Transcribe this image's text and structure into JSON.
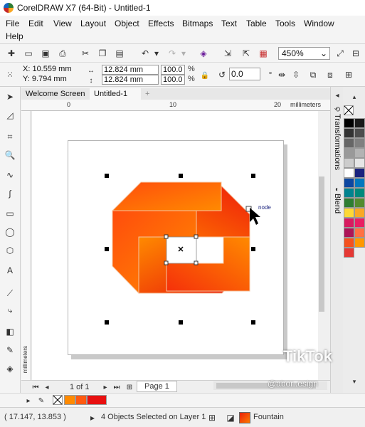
{
  "window": {
    "title": "CorelDRAW X7 (64-Bit) - Untitled-1"
  },
  "menu": {
    "items": [
      "File",
      "Edit",
      "View",
      "Layout",
      "Object",
      "Effects",
      "Bitmaps",
      "Text",
      "Table",
      "Tools",
      "Window"
    ],
    "row2": [
      "Help"
    ]
  },
  "toolbar": {
    "zoom": "450%",
    "zoom_options": [
      "450%"
    ]
  },
  "properties": {
    "x": "X: 10.559 mm",
    "y": "Y: 9.794 mm",
    "width": "12.824 mm",
    "height": "12.824 mm",
    "scale_x": "100.0",
    "scale_y": "100.0",
    "pct_x": "%",
    "pct_y": "%",
    "rotation": "0.0"
  },
  "tabs": [
    "Welcome Screen",
    "Untitled-1"
  ],
  "ruler": {
    "h_ticks": [
      "0",
      "10",
      "20"
    ],
    "unit": "millimeters",
    "v_unit": "millimeters"
  },
  "canvas": {
    "node_label": "node",
    "watermark": "TikTok",
    "watermark_handle": "@abor..esign"
  },
  "dockers": [
    "Transformations",
    "Blend"
  ],
  "palette": {
    "colors": [
      "#000000",
      "#1a1a1a",
      "#333333",
      "#4d4d4d",
      "#666666",
      "#808080",
      "#999999",
      "#b3b3b3",
      "#cccccc",
      "#e6e6e6",
      "#ffffff",
      "#1a237e",
      "#0d47a1",
      "#0277bd",
      "#00838f",
      "#00897b",
      "#2e7d32",
      "#558b2f",
      "#fdd835",
      "#f9a825",
      "#d81b60",
      "#e91e63",
      "#ad1457",
      "#ff7043",
      "#f4511e",
      "#ff9800",
      "#e53935"
    ]
  },
  "bottom": {
    "page_counter": "1 of 1",
    "page_tab": "Page 1"
  },
  "doc_palette": {
    "colors": [
      "#ff8a00",
      "#ff5a10",
      "#e81010"
    ]
  },
  "status": {
    "coords": "( 17.147, 13.853 )",
    "selection": "4 Objects Selected on Layer 1",
    "fill_type": "Fountain",
    "fill_colors": [
      "#e8200a",
      "#ff7a00"
    ]
  },
  "colors": {
    "gradient_start": "#e8150a",
    "gradient_end": "#ff8a00"
  }
}
